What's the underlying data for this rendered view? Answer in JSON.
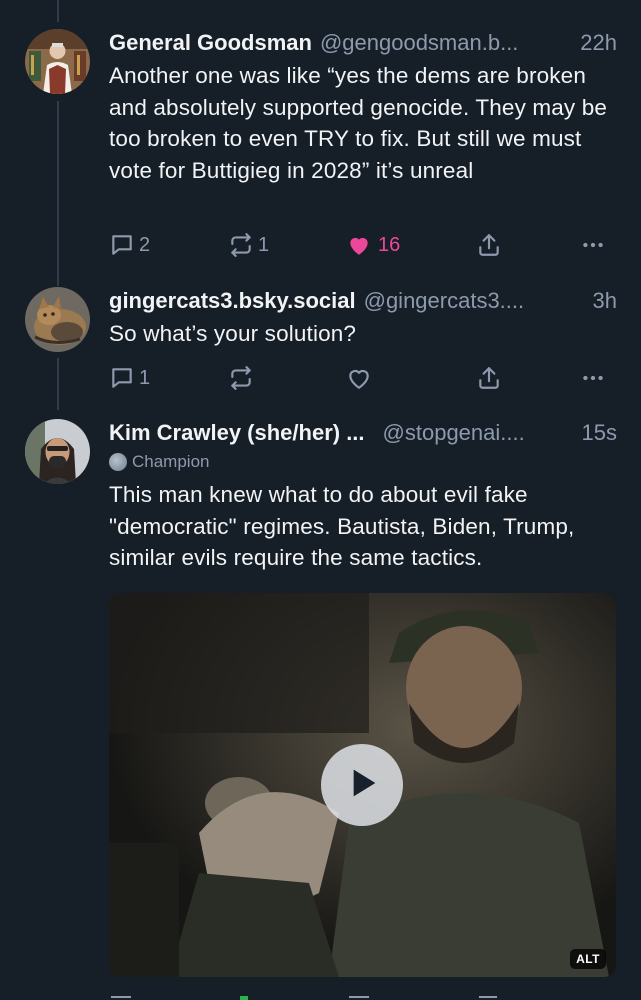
{
  "posts": [
    {
      "name": "General Goodsman",
      "handle": "@gengoodsman.b...",
      "time": "22h",
      "text": "Another one was like “yes the dems are broken and absolutely supported genocide. They may be too broken to even TRY to fix. But still we must vote for Buttigieg in 2028” it’s unreal",
      "replies": "2",
      "reposts": "1",
      "likes": "16",
      "liked": true
    },
    {
      "name": "gingercats3.bsky.social",
      "handle": "@gingercats3....",
      "time": "3h",
      "text": "So what’s your solution?",
      "replies": "1",
      "reposts": "",
      "likes": "",
      "liked": false
    },
    {
      "name": "Kim Crawley (she/her) ...",
      "handle": "@stopgenai....",
      "time": "15s",
      "badge": "Champion",
      "text": "This man knew what to do about evil fake \"democratic\" regimes. Bautista, Biden, Trump, similar evils require the same tactics.",
      "media": {
        "type": "video",
        "alt_label": "ALT"
      }
    }
  ],
  "colors": {
    "background": "#161e27",
    "text": "#f1f3f5",
    "muted": "#8d9aad",
    "like": "#ec4899",
    "thread_line": "#2e3c4e"
  },
  "icons": [
    "reply-icon",
    "repost-icon",
    "heart-icon",
    "share-icon",
    "more-icon",
    "play-icon"
  ]
}
